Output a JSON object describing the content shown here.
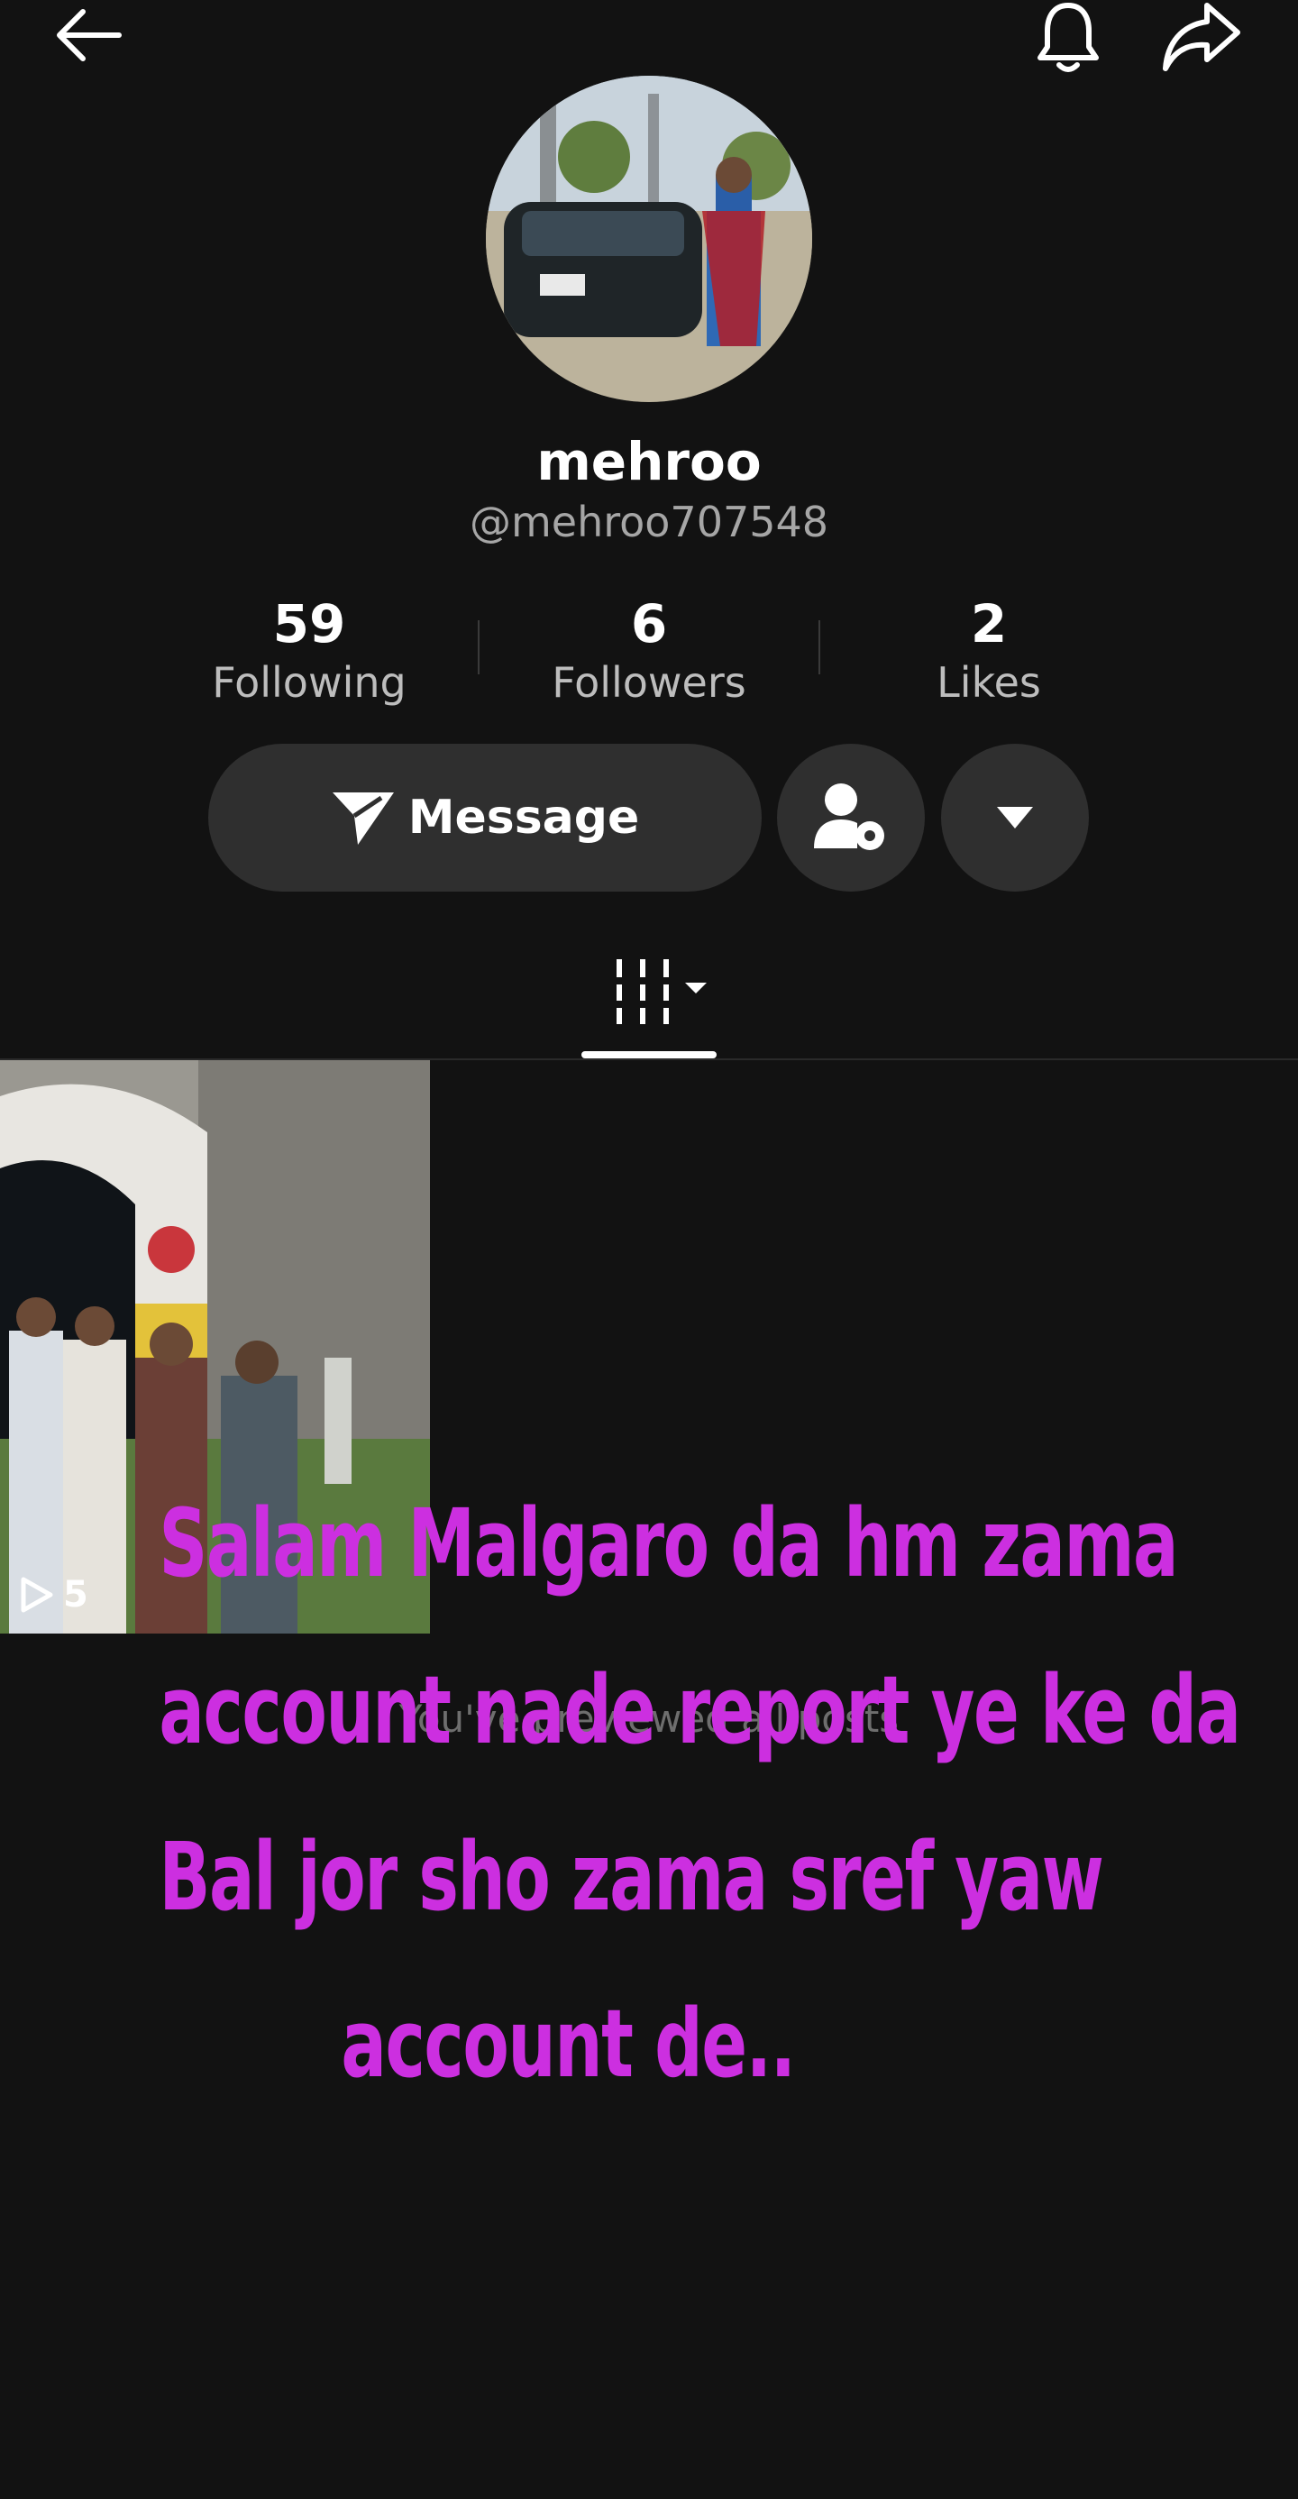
{
  "profile": {
    "display_name": "mehroo",
    "handle": "@mehroo707548"
  },
  "stats": [
    {
      "value": "59",
      "label": "Following"
    },
    {
      "value": "6",
      "label": "Followers"
    },
    {
      "value": "2",
      "label": "Likes"
    }
  ],
  "actions": {
    "message_label": "Message"
  },
  "posts": [
    {
      "views": "5"
    }
  ],
  "footer_note": "You've previewed all posts",
  "overlay_text": {
    "line1": "Salam Malgaro da hm zama",
    "line2": "account nade report ye ke da",
    "line3": "Bal jor sho zama sref yaw",
    "line4": "account de.."
  },
  "colors": {
    "background": "#121212",
    "overlay": "#cc2fe0",
    "button": "#2f2f2f"
  },
  "icons": [
    "back-arrow-icon",
    "bell-icon",
    "share-icon",
    "send-icon",
    "user-settings-icon",
    "caret-down-icon",
    "grid-icon",
    "play-icon"
  ]
}
